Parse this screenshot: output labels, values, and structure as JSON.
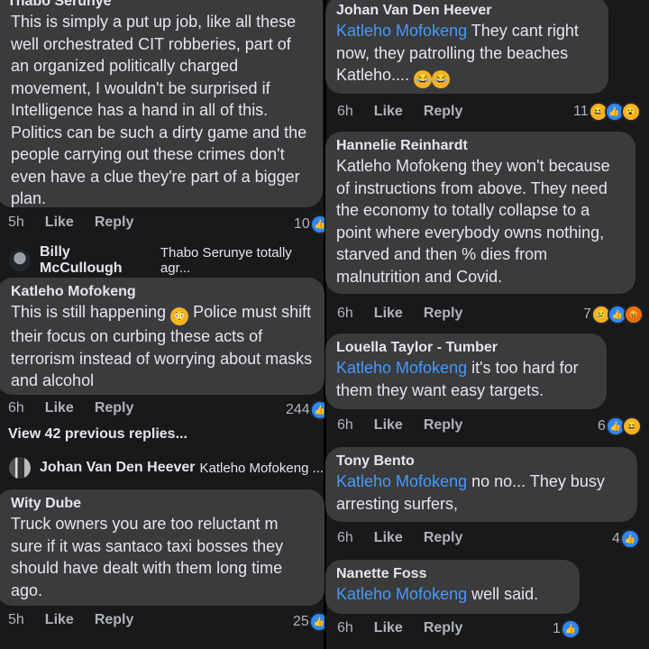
{
  "left": {
    "c1": {
      "author": "Thabo Serunye",
      "text": "This is simply a put up job, like all these well orchestrated CIT robberies, part of an organized politically charged movement, I wouldn't be surprised if Intelligence has a hand in all of this. Politics can be such a dirty game and the people carrying out these crimes don't even have a clue they're part of a bigger plan.",
      "time": "5h",
      "like": "Like",
      "reply": "Reply",
      "count": "10"
    },
    "r1": {
      "name": "Billy McCullough",
      "text": "Thabo Serunye totally agr..."
    },
    "c2": {
      "author": "Katleho Mofokeng",
      "text_a": "This is still happening",
      "text_b": "Police must shift their focus on curbing these acts of terrorism instead of worrying about masks and alcohol",
      "time": "6h",
      "like": "Like",
      "reply": "Reply",
      "count": "244"
    },
    "view_more": "View 42 previous replies...",
    "r2": {
      "name": "Johan Van Den Heever",
      "text": "Katleho Mofokeng ..."
    },
    "c3": {
      "author": "Wity Dube",
      "text": "Truck owners you are too reluctant m sure if it was santaco taxi bosses they should have dealt with them long time ago.",
      "time": "5h",
      "like": "Like",
      "reply": "Reply",
      "count": "25"
    }
  },
  "right": {
    "c1": {
      "author": "Johan Van Den Heever",
      "mention": "Katleho Mofokeng",
      "text": " They cant right now, they patrolling the beaches Katleho....",
      "time": "6h",
      "like": "Like",
      "reply": "Reply",
      "count": "11"
    },
    "c2": {
      "author": "Hannelie Reinhardt",
      "text": "Katleho Mofokeng they won't because of instructions from above. They need the economy to totally collapse to a point where everybody owns nothing, starved and then % dies from malnutrition and Covid.",
      "time": "6h",
      "like": "Like",
      "reply": "Reply",
      "count": "7"
    },
    "c3": {
      "author": "Louella Taylor - Tumber",
      "mention": "Katleho Mofokeng",
      "text": " it's too hard for them they want easy targets.",
      "time": "6h",
      "like": "Like",
      "reply": "Reply",
      "count": "6"
    },
    "c4": {
      "author": "Tony Bento",
      "mention": "Katleho Mofokeng",
      "text": " no no... They busy arresting surfers,",
      "time": "6h",
      "like": "Like",
      "reply": "Reply",
      "count": "4"
    },
    "c5": {
      "author": "Nanette Foss",
      "mention": "Katleho Mofokeng",
      "text": " well said.",
      "time": "6h",
      "like": "Like",
      "reply": "Reply",
      "count": "1"
    }
  },
  "colors": {
    "bubble": "#3a3b3c",
    "text": "#e4e6eb",
    "muted": "#b0b3b8",
    "mention": "#4599ff",
    "like_icon": "#2d88ff",
    "emoji": "#f7b125",
    "angry": "#e9710f"
  },
  "icons": {
    "like": "thumbs-up-icon",
    "haha": "laughing-emoji-icon",
    "wow": "wow-emoji-icon",
    "sad": "sad-emoji-icon",
    "angry": "angry-emoji-icon",
    "flushed": "flushed-emoji-icon"
  }
}
